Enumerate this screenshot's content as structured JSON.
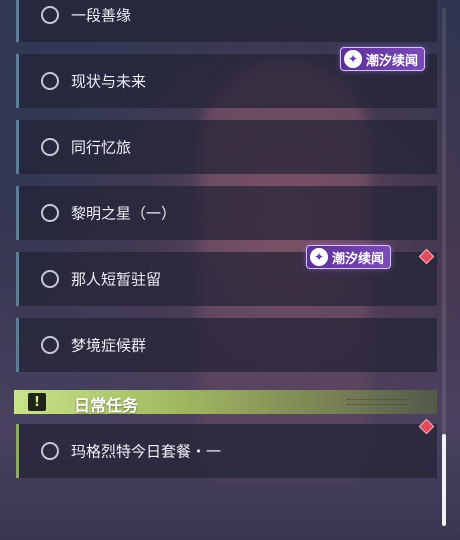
{
  "quests": [
    {
      "label": "一段善缘"
    },
    {
      "label": "现状与未来"
    },
    {
      "label": "同行忆旅"
    },
    {
      "label": "黎明之星（一）"
    },
    {
      "label": "那人短暂驻留"
    },
    {
      "label": "梦境症候群"
    }
  ],
  "badges": [
    {
      "label": "潮汐续闻",
      "icon": "sparkle-icon"
    },
    {
      "label": "潮汐续闻",
      "icon": "sparkle-icon"
    }
  ],
  "daily_section": {
    "title": "日常任务",
    "icon": "exclamation-icon",
    "quests": [
      {
        "label": "玛格烈特今日套餐・一"
      }
    ]
  },
  "colors": {
    "badge": "#6a3ca8",
    "section_accent": "#c8e08a",
    "diamond": "#e0495f"
  }
}
